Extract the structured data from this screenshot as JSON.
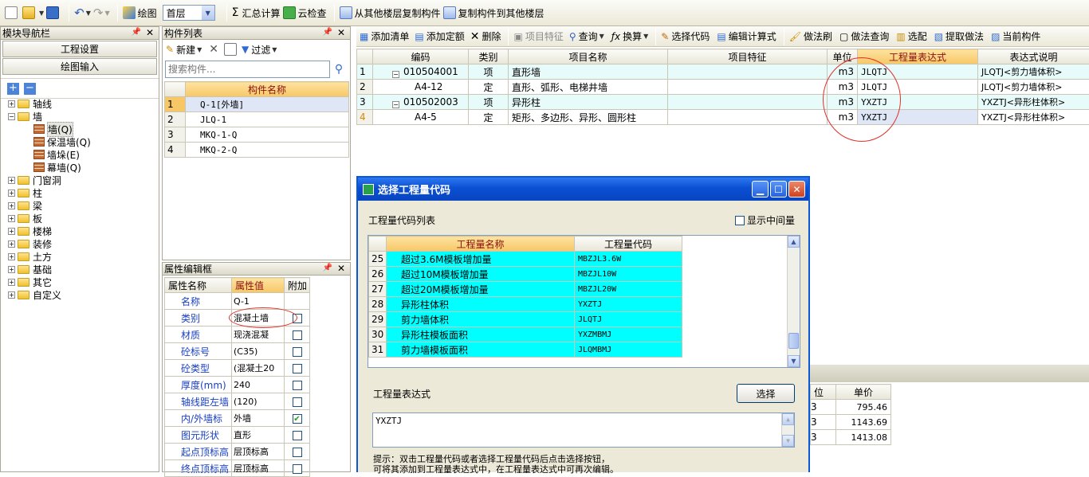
{
  "toolbar": {
    "draw": "绘图",
    "floor": "首层",
    "sum": "汇总计算",
    "cloud": "云检查",
    "copy_from": "从其他楼层复制构件",
    "copy_to": "复制构件到其他楼层"
  },
  "nav": {
    "title": "模块导航栏",
    "btn_project": "工程设置",
    "btn_draw": "绘图输入",
    "tree": [
      {
        "label": "轴线",
        "type": "folder",
        "level": 0,
        "exp": "+"
      },
      {
        "label": "墙",
        "type": "folder",
        "level": 0,
        "exp": "-"
      },
      {
        "label": "墙(Q)",
        "type": "wall",
        "level": 1
      },
      {
        "label": "保温墙(Q)",
        "type": "wall",
        "level": 1
      },
      {
        "label": "墙垛(E)",
        "type": "wall",
        "level": 1
      },
      {
        "label": "幕墙(Q)",
        "type": "wall",
        "level": 1
      },
      {
        "label": "门窗洞",
        "type": "folder",
        "level": 0,
        "exp": "+"
      },
      {
        "label": "柱",
        "type": "folder",
        "level": 0,
        "exp": "+"
      },
      {
        "label": "梁",
        "type": "folder",
        "level": 0,
        "exp": "+"
      },
      {
        "label": "板",
        "type": "folder",
        "level": 0,
        "exp": "+"
      },
      {
        "label": "楼梯",
        "type": "folder",
        "level": 0,
        "exp": "+"
      },
      {
        "label": "装修",
        "type": "folder",
        "level": 0,
        "exp": "+"
      },
      {
        "label": "土方",
        "type": "folder",
        "level": 0,
        "exp": "+"
      },
      {
        "label": "基础",
        "type": "folder",
        "level": 0,
        "exp": "+"
      },
      {
        "label": "其它",
        "type": "folder",
        "level": 0,
        "exp": "+"
      },
      {
        "label": "自定义",
        "type": "folder",
        "level": 0,
        "exp": "+"
      }
    ]
  },
  "complist": {
    "title": "构件列表",
    "new": "新建",
    "filter": "过滤",
    "search_placeholder": "搜索构件...",
    "col": "构件名称",
    "rows": [
      {
        "n": "1",
        "name": "Q-1[外墙]"
      },
      {
        "n": "2",
        "name": "JLQ-1"
      },
      {
        "n": "3",
        "name": "MKQ-1-Q"
      },
      {
        "n": "4",
        "name": "MKQ-2-Q"
      }
    ]
  },
  "props": {
    "title": "属性编辑框",
    "h_name": "属性名称",
    "h_val": "属性值",
    "h_add": "附加",
    "rows": [
      {
        "name": "名称",
        "val": "Q-1",
        "chk": null
      },
      {
        "name": "类别",
        "val": "混凝土墙",
        "chk": false
      },
      {
        "name": "材质",
        "val": "现浇混凝",
        "chk": false
      },
      {
        "name": "砼标号",
        "val": "(C35)",
        "chk": false
      },
      {
        "name": "砼类型",
        "val": "(混凝土20",
        "chk": false
      },
      {
        "name": "厚度(mm)",
        "val": "240",
        "chk": false
      },
      {
        "name": "轴线距左墙",
        "val": "(120)",
        "chk": false
      },
      {
        "name": "内/外墙标",
        "val": "外墙",
        "chk": true
      },
      {
        "name": "图元形状",
        "val": "直形",
        "chk": false
      },
      {
        "name": "起点顶标高",
        "val": "层顶标高",
        "chk": false
      },
      {
        "name": "终点顶标高",
        "val": "层顶标高",
        "chk": false
      }
    ]
  },
  "right_toolbar": {
    "add_list": "添加清单",
    "add_quota": "添加定额",
    "delete": "删除",
    "feature": "项目特征",
    "query": "查询",
    "convert": "换算",
    "select_code": "选择代码",
    "edit_formula": "编辑计算式",
    "brush": "做法刷",
    "method_query": "做法查询",
    "match": "选配",
    "extract": "提取做法",
    "current": "当前构件"
  },
  "main_table": {
    "headers": [
      "编码",
      "类别",
      "项目名称",
      "项目特征",
      "单位",
      "工程量表达式",
      "表达式说明"
    ],
    "rows": [
      {
        "n": "1",
        "code": "010504001",
        "cat": "项",
        "name": "直形墙",
        "feat": "",
        "unit": "m3",
        "expr": "JLQTJ",
        "desc": "JLQTJ<剪力墙体积>",
        "cyan": true,
        "tree": "-"
      },
      {
        "n": "2",
        "code": "A4-12",
        "cat": "定",
        "name": "直形、弧形、电梯井墙",
        "feat": "",
        "unit": "m3",
        "expr": "JLQTJ",
        "desc": "JLQTJ<剪力墙体积>",
        "cyan": false,
        "tree": ""
      },
      {
        "n": "3",
        "code": "010502003",
        "cat": "项",
        "name": "异形柱",
        "feat": "",
        "unit": "m3",
        "expr": "YXZTJ",
        "desc": "YXZTJ<异形柱体积>",
        "cyan": true,
        "tree": "-"
      },
      {
        "n": "4",
        "code": "A4-5",
        "cat": "定",
        "name": "矩形、多边形、异形、圆形柱",
        "feat": "",
        "unit": "m3",
        "expr": "YXZTJ",
        "desc": "YXZTJ<异形柱体积>",
        "cyan": false,
        "tree": ""
      }
    ]
  },
  "lower_table": {
    "h_unit": "位",
    "h_price": "单价",
    "rows": [
      {
        "unit": "3",
        "price": "795.46"
      },
      {
        "unit": "3",
        "price": "1143.69"
      },
      {
        "unit": "3",
        "price": "1413.08"
      }
    ]
  },
  "dialog": {
    "title": "选择工程量代码",
    "list_label": "工程量代码列表",
    "show_mid": "显示中间量",
    "h_name": "工程量名称",
    "h_code": "工程量代码",
    "rows": [
      {
        "n": "25",
        "name": "超过3.6M模板增加量",
        "code": "MBZJL3.6W"
      },
      {
        "n": "26",
        "name": "超过10M模板增加量",
        "code": "MBZJL10W"
      },
      {
        "n": "27",
        "name": "超过20M模板增加量",
        "code": "MBZJL20W"
      },
      {
        "n": "28",
        "name": "异形柱体积",
        "code": "YXZTJ"
      },
      {
        "n": "29",
        "name": "剪力墙体积",
        "code": "JLQTJ"
      },
      {
        "n": "30",
        "name": "异形柱模板面积",
        "code": "YXZMBMJ"
      },
      {
        "n": "31",
        "name": "剪力墙模板面积",
        "code": "JLQMBMJ"
      }
    ],
    "expr_label": "工程量表达式",
    "select_btn": "选择",
    "expr_value": "YXZTJ",
    "hint1": "提示：双击工程量代码或者选择工程量代码后点击选择按钮，",
    "hint2": "可将其添加到工程量表达式中，在工程量表达式中可再次编辑。"
  },
  "colors": {
    "accent": "#0a4fd3",
    "cyan": "#00ffff",
    "header_hl": "#f7c766",
    "annot": "#e0302a"
  }
}
